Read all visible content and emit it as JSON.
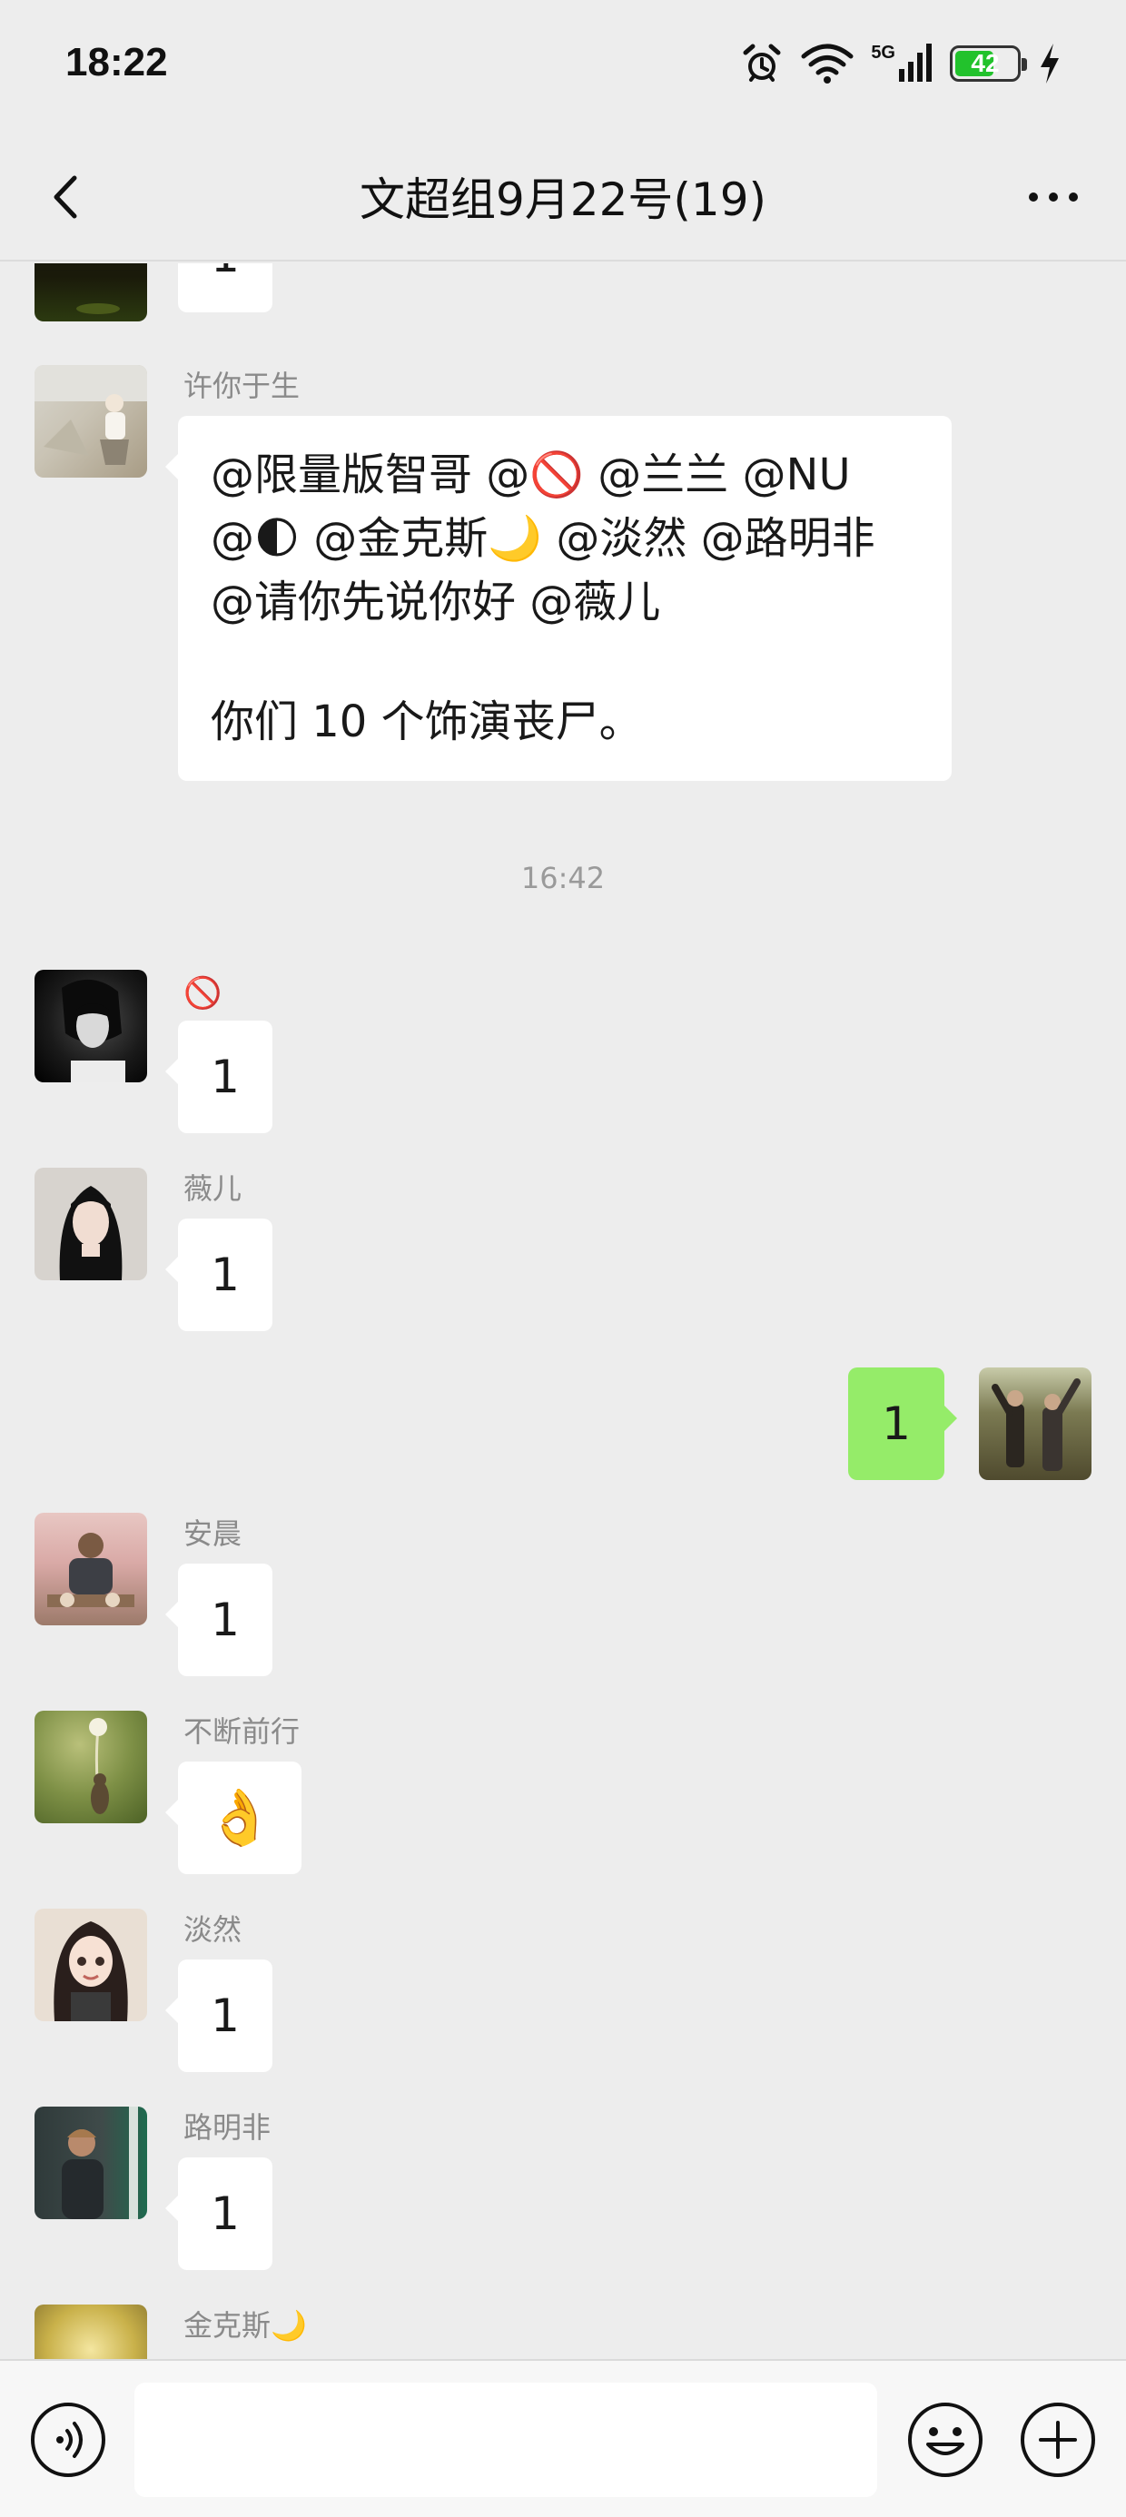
{
  "status_bar": {
    "time": "18:22",
    "network": "5G",
    "battery": "42",
    "icons": [
      "alarm-icon",
      "wifi-icon",
      "signal-icon",
      "battery-icon",
      "charging-icon"
    ]
  },
  "header": {
    "title": "文超组9月22号(19)",
    "back_icon": "chevron-left-icon",
    "more_icon": "more-dots-icon"
  },
  "messages": [
    {
      "sender": "",
      "text": "1",
      "side": "left",
      "partial": true
    },
    {
      "sender": "许你于生",
      "lines": [
        "@限量版智哥 @🚫 @兰兰 @NU",
        "@🌓 @金克斯🌙 @淡然 @路明非",
        "@请你先说你好 @薇儿",
        "你们 10 个饰演丧尸。"
      ],
      "side": "left"
    },
    {
      "timestamp": "16:42"
    },
    {
      "sender": "🚫",
      "text": "1",
      "side": "left"
    },
    {
      "sender": "薇儿",
      "text": "1",
      "side": "left"
    },
    {
      "sender": "",
      "text": "1",
      "side": "right"
    },
    {
      "sender": "安晨",
      "text": "1",
      "side": "left"
    },
    {
      "sender": "不断前行",
      "text": "👌",
      "side": "left"
    },
    {
      "sender": "淡然",
      "text": "1",
      "side": "left"
    },
    {
      "sender": "路明非",
      "text": "1",
      "side": "left"
    },
    {
      "sender": "金克斯🌙",
      "text": "",
      "side": "left",
      "partial": true
    }
  ],
  "input_bar": {
    "voice_icon": "voice-icon",
    "input_value": "",
    "emoji_icon": "emoji-icon",
    "plus_icon": "plus-icon"
  },
  "colors": {
    "background": "#ededed",
    "my_bubble": "#95ec69",
    "other_bubble": "#ffffff",
    "battery_fill": "#22c22c"
  }
}
